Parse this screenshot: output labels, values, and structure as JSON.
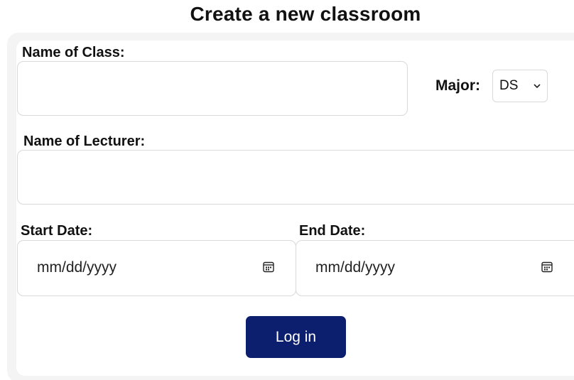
{
  "page": {
    "title": "Create a new classroom"
  },
  "form": {
    "class_name": {
      "label": "Name of Class:",
      "value": ""
    },
    "major": {
      "label": "Major:",
      "selected": "DS"
    },
    "lecturer_name": {
      "label": "Name of Lecturer:",
      "value": ""
    },
    "start_date": {
      "label": "Start Date:",
      "placeholder": "mm/dd/yyyy",
      "icon": "calendar-icon"
    },
    "end_date": {
      "label": "End Date:",
      "placeholder": "mm/dd/yyyy",
      "icon": "calendar-icon"
    },
    "submit_label": "Log in"
  },
  "colors": {
    "button": "#0b1f6e",
    "border": "#d9d9d9"
  }
}
